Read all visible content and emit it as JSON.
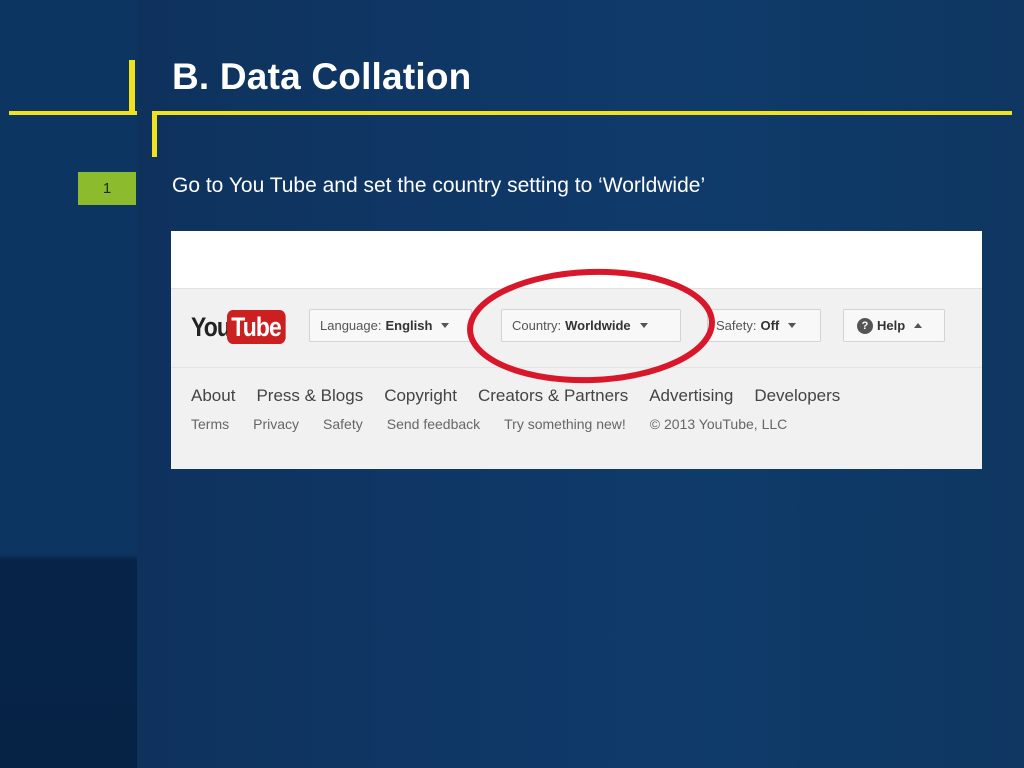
{
  "slide": {
    "title": "B.  Data Collation",
    "step_number": "1",
    "step_text": "Go to You Tube and set the country setting to ‘Worldwide’",
    "accent_color": "#f0e21c",
    "badge_color": "#8dbb2e"
  },
  "youtube": {
    "logo_you": "You",
    "logo_tube": "Tube",
    "language_label": "Language:",
    "language_value": "English",
    "country_label": "Country:",
    "country_value": "Worldwide",
    "safety_label": "Safety:",
    "safety_value": "Off",
    "help_label": "Help",
    "help_icon_glyph": "?",
    "links_primary": [
      "About",
      "Press & Blogs",
      "Copyright",
      "Creators & Partners",
      "Advertising",
      "Developers"
    ],
    "links_secondary": [
      "Terms",
      "Privacy",
      "Safety",
      "Send feedback",
      "Try something new!",
      "© 2013 YouTube, LLC"
    ],
    "highlight_color": "#d8182a"
  }
}
